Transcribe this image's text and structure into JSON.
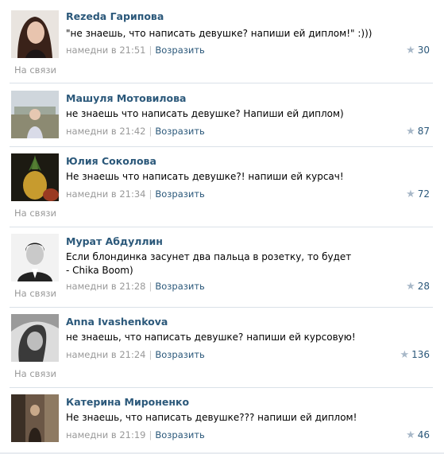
{
  "comments": [
    {
      "author": "Rezeda Гарипова",
      "text": "\"не знаешь, что написать девушке? напиши ей диплом!\" :)))",
      "time": "намедни в 21:51",
      "reply_label": "Возразить",
      "likes": "30",
      "status": "На связи",
      "avatar_icon": "avatar-photo"
    },
    {
      "author": "Машуля Мотовилова",
      "text": "не знаешь что написать девушке? Напиши ей диплом)",
      "time": "намедни в 21:42",
      "reply_label": "Возразить",
      "likes": "87",
      "status": "",
      "avatar_icon": "avatar-photo"
    },
    {
      "author": "Юлия Соколова",
      "text": "Не знаешь что написать девушке?! напиши ей курсач!",
      "time": "намедни в 21:34",
      "reply_label": "Возразить",
      "likes": "72",
      "status": "На связи",
      "avatar_icon": "avatar-photo"
    },
    {
      "author": "Мурат Абдуллин",
      "text": "Если блондинка засунет два пальца в розетку, то будет - Chika Boom)",
      "time": "намедни в 21:28",
      "reply_label": "Возразить",
      "likes": "28",
      "status": "На связи",
      "avatar_icon": "avatar-photo"
    },
    {
      "author": "Anna Ivashenkova",
      "text": "не знаешь, что написать девушке? напиши ей курсовую!",
      "time": "намедни в 21:24",
      "reply_label": "Возразить",
      "likes": "136",
      "status": "На связи",
      "avatar_icon": "avatar-photo"
    },
    {
      "author": "Катерина Мироненко",
      "text": "Не знаешь, что написать девушке??? напиши ей диплом!",
      "time": "намедни в 21:19",
      "reply_label": "Возразить",
      "likes": "46",
      "status": "",
      "avatar_icon": "avatar-photo"
    }
  ],
  "like_icon": "star-icon"
}
